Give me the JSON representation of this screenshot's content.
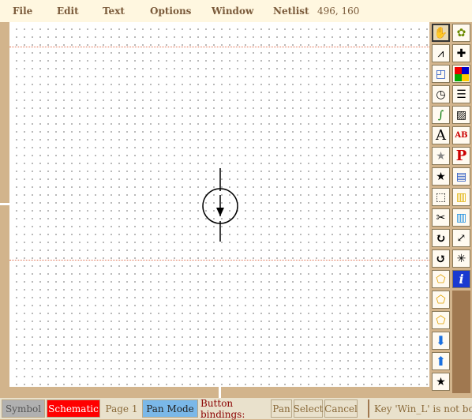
{
  "menu": {
    "items": [
      "File",
      "Edit",
      "Text",
      "Options",
      "Window",
      "Netlist"
    ],
    "coords": "496, 160"
  },
  "toolbar": {
    "icons": [
      "pan-hand-icon",
      "library-icon",
      "wire-icon",
      "symbol-icon",
      "box-icon",
      "color-icon",
      "arc-icon",
      "line-style-icon",
      "spline-icon",
      "fill-pattern-icon",
      "text-icon",
      "font-icon",
      "label-star-icon",
      "parameter-icon",
      "select-star-icon",
      "book-icon",
      "copy-icon",
      "open-book-icon",
      "cut-scissors-icon",
      "book-open-icon",
      "rotate-icon",
      "zoom-in-icon",
      "rotate-reverse-icon",
      "zoom-out-icon",
      "push-icon",
      "info-icon",
      "pop-icon",
      "edit-icon",
      "down-arrow-icon",
      "up-arrow-icon",
      "library-book-icon"
    ]
  },
  "status": {
    "symbol": "Symbol",
    "schematic": "Schematic",
    "page": "Page 1",
    "mode": "Pan Mode",
    "bindings_label": "Button bindings:",
    "pan": "Pan",
    "select": "Select",
    "cancel": "Cancel",
    "message": "Key 'Win_L' is not bound"
  },
  "colors": {
    "background": "#d2b48c",
    "menubar": "#fff7e0",
    "schematic_tab": "#ff0000",
    "mode_tab": "#7ab8e8"
  }
}
